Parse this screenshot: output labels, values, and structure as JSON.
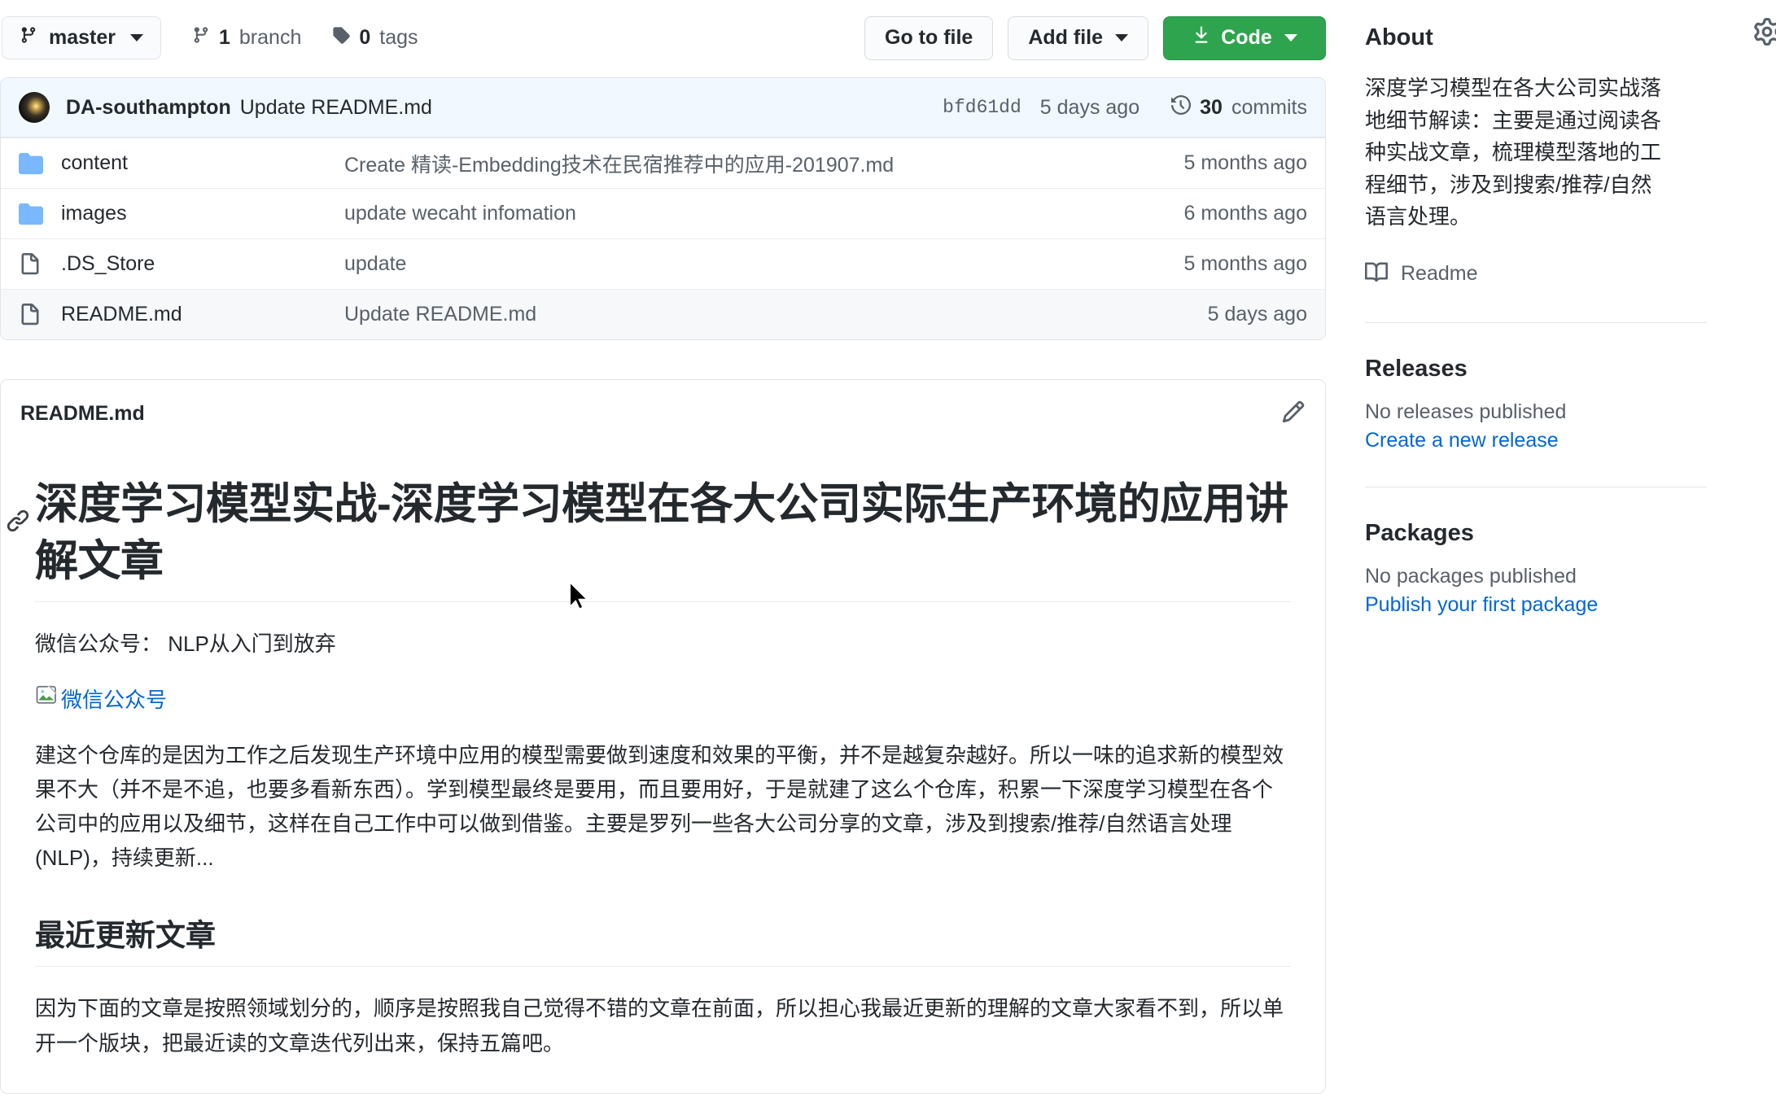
{
  "toolbar": {
    "branch_name": "master",
    "branch_icon": "git-branch-icon",
    "branch_count_label": "1",
    "branch_count_word": "branch",
    "tag_count_label": "0",
    "tag_count_word": "tags",
    "go_to_file_label": "Go to file",
    "add_file_label": "Add file",
    "code_label": "Code"
  },
  "commit_bar": {
    "author": "DA-southampton",
    "message": "Update README.md",
    "sha": "bfd61dd",
    "time": "5 days ago",
    "commits_count": "30",
    "commits_word": "commits"
  },
  "files": [
    {
      "name": "content",
      "type": "folder",
      "commit": "Create 精读-Embedding技术在民宿推荐中的应用-201907.md",
      "time": "5 months ago",
      "highlight": false
    },
    {
      "name": "images",
      "type": "folder",
      "commit": "update wecaht infomation",
      "time": "6 months ago",
      "highlight": false
    },
    {
      "name": ".DS_Store",
      "type": "file",
      "commit": "update",
      "time": "5 months ago",
      "highlight": false
    },
    {
      "name": "README.md",
      "type": "file",
      "commit": "Update README.md",
      "time": "5 days ago",
      "highlight": true
    }
  ],
  "readme": {
    "filename": "README.md",
    "edit_icon": "pencil-icon",
    "h1": "深度学习模型实战-深度学习模型在各大公司实际生产环境的应用讲解文章",
    "wechat_line": "微信公众号： NLP从入门到放弃",
    "broken_image_alt": "微信公众号",
    "paragraph_1": "建这个仓库的是因为工作之后发现生产环境中应用的模型需要做到速度和效果的平衡，并不是越复杂越好。所以一味的追求新的模型效果不大（并不是不追，也要多看新东西）。学到模型最终是要用，而且要用好，于是就建了这么个仓库，积累一下深度学习模型在各个公司中的应用以及细节，这样在自己工作中可以做到借鉴。主要是罗列一些各大公司分享的文章，涉及到搜索/推荐/自然语言处理(NLP)，持续更新...",
    "h2": "最近更新文章",
    "paragraph_2": "因为下面的文章是按照领域划分的，顺序是按照我自己觉得不错的文章在前面，所以担心我最近更新的理解的文章大家看不到，所以单开一个版块，把最近读的文章迭代列出来，保持五篇吧。"
  },
  "sidebar": {
    "about_title": "About",
    "gear_icon": "gear-icon",
    "description": "深度学习模型在各大公司实战落地细节解读：主要是通过阅读各种实战文章，梳理模型落地的工程细节，涉及到搜索/推荐/自然语言处理。",
    "readme_link": "Readme",
    "readme_icon": "book-icon",
    "releases_title": "Releases",
    "releases_note": "No releases published",
    "releases_link": "Create a new release",
    "packages_title": "Packages",
    "packages_note": "No packages published",
    "packages_link": "Publish your first package"
  },
  "colors": {
    "accent_green": "#2ea44f",
    "link_blue": "#0366d6",
    "commit_bar_bg": "#f1f8ff",
    "folder_blue": "#79b8ff",
    "border": "#e1e4e8",
    "muted_text": "#586069"
  }
}
